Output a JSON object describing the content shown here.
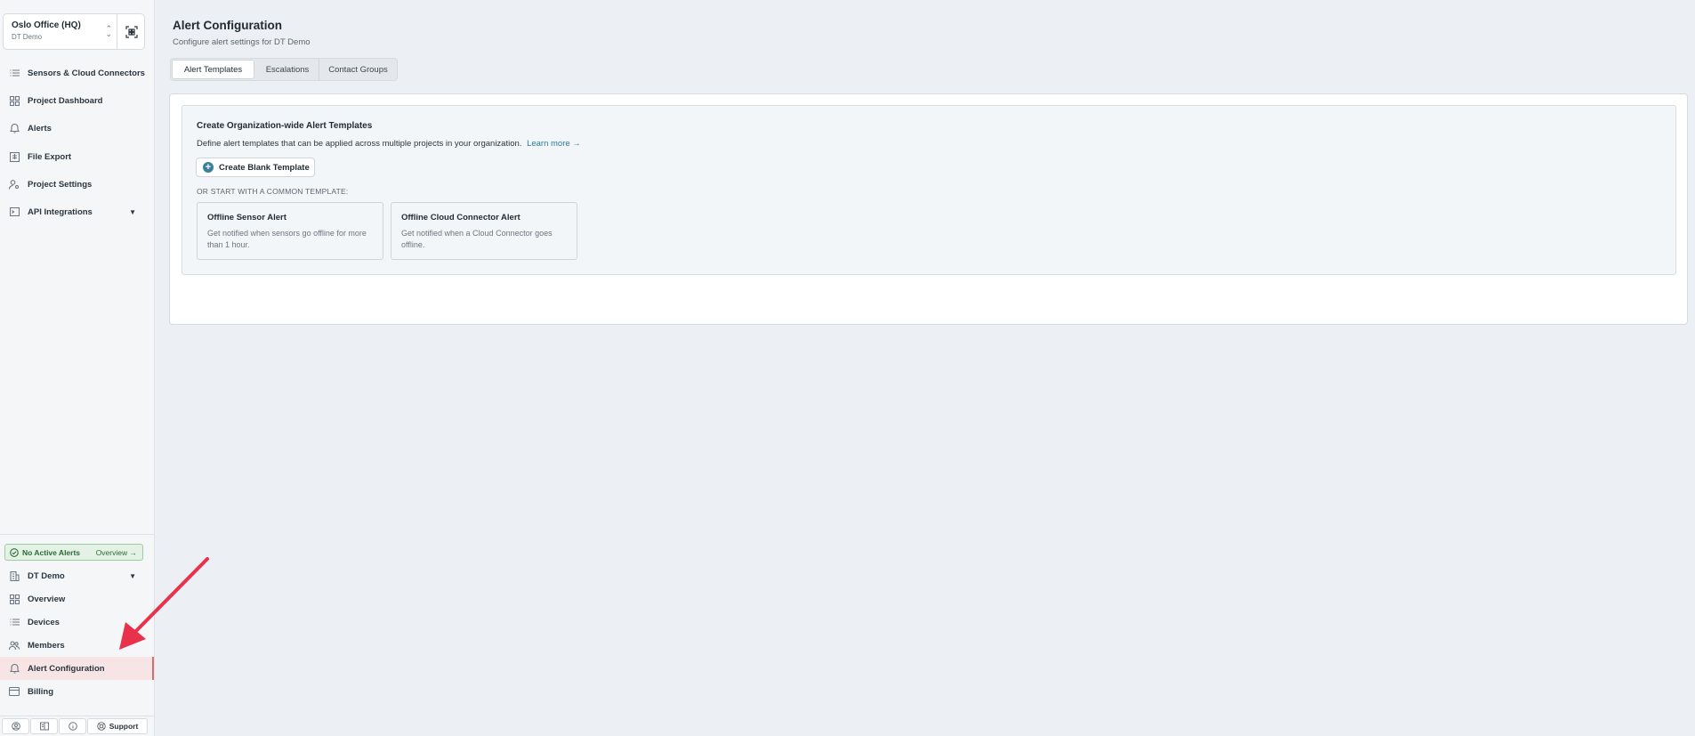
{
  "location": {
    "name": "Oslo Office (HQ)",
    "org": "DT Demo"
  },
  "nav_top": [
    {
      "label": "Sensors & Cloud Connectors",
      "icon": "list-icon"
    },
    {
      "label": "Project Dashboard",
      "icon": "dashboard-icon"
    },
    {
      "label": "Alerts",
      "icon": "bell-icon"
    },
    {
      "label": "File Export",
      "icon": "file-export-icon"
    },
    {
      "label": "Project Settings",
      "icon": "user-settings-icon"
    },
    {
      "label": "API Integrations",
      "icon": "api-icon"
    }
  ],
  "alerts_status": {
    "label": "No Active Alerts",
    "overview": "Overview"
  },
  "nav_bottom": [
    {
      "label": "DT Demo",
      "icon": "building-icon"
    },
    {
      "label": "Overview",
      "icon": "dashboard-icon"
    },
    {
      "label": "Devices",
      "icon": "list-icon"
    },
    {
      "label": "Members",
      "icon": "members-icon"
    },
    {
      "label": "Alert Configuration",
      "icon": "bell-icon"
    },
    {
      "label": "Billing",
      "icon": "card-icon"
    }
  ],
  "footer": {
    "support_label": "Support"
  },
  "header": {
    "title": "Alert Configuration",
    "subtitle": "Configure alert settings for DT Demo"
  },
  "tabs": [
    {
      "label": "Alert Templates",
      "active": true
    },
    {
      "label": "Escalations",
      "active": false
    },
    {
      "label": "Contact Groups",
      "active": false
    }
  ],
  "templates_section": {
    "title": "Create Organization-wide Alert Templates",
    "description": "Define alert templates that can be applied across multiple projects in your organization.",
    "learn_more": "Learn more →",
    "create_button": "Create Blank Template",
    "or_label": "OR START WITH A COMMON TEMPLATE:",
    "templates": [
      {
        "title": "Offline Sensor Alert",
        "description": "Get notified when sensors go offline for more than 1 hour."
      },
      {
        "title": "Offline Cloud Connector Alert",
        "description": "Get notified when a Cloud Connector goes offline."
      }
    ]
  },
  "colors": {
    "accent": "#3a7f9b",
    "active_nav_bg": "#f7e4e4",
    "alert_ok": "#2b6a35",
    "annotation_arrow": "#e8314a"
  }
}
